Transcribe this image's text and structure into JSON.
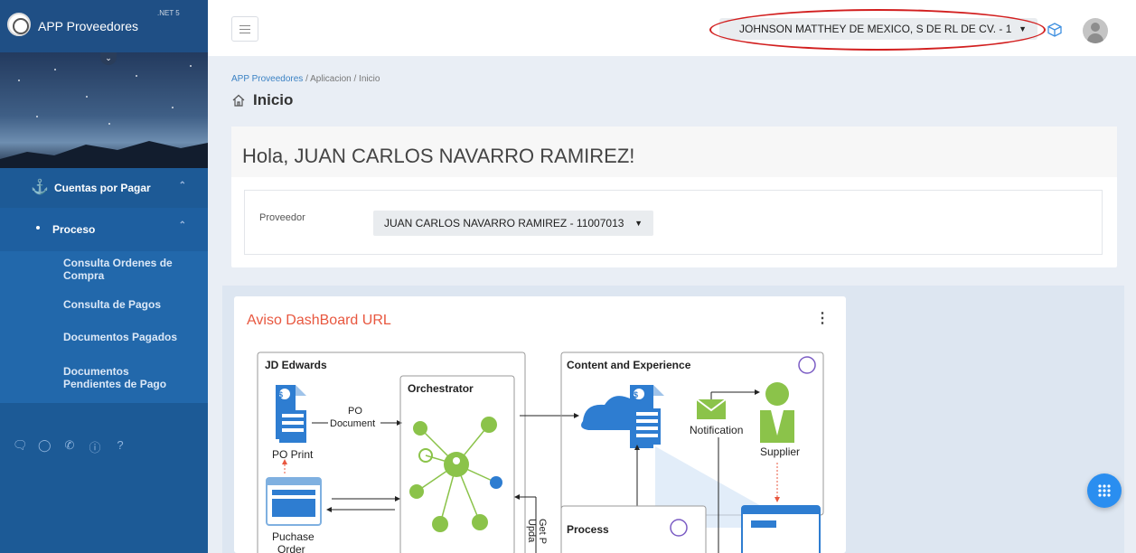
{
  "app": {
    "title": "APP Proveedores",
    "version": ".NET 5"
  },
  "sidebar": {
    "section": {
      "label": "Cuentas por Pagar"
    },
    "group": {
      "label": "Proceso"
    },
    "items": [
      {
        "label": "Consulta Ordenes de Compra"
      },
      {
        "label": "Consulta de Pagos"
      },
      {
        "label": "Documentos Pagados"
      },
      {
        "label": "Documentos Pendientes de Pago"
      }
    ],
    "footer_icons": [
      "chat-icon",
      "globe-icon",
      "phone-icon",
      "info-icon",
      "help-icon"
    ]
  },
  "header": {
    "company": "JOHNSON MATTHEY DE MEXICO, S DE RL DE CV. - 1"
  },
  "breadcrumb": {
    "root": "APP Proveedores",
    "section": "Aplicacion",
    "current": "Inicio"
  },
  "page": {
    "title": "Inicio",
    "greeting": "Hola, JUAN CARLOS NAVARRO RAMIREZ!",
    "provider_label": "Proveedor",
    "provider_value": "JUAN CARLOS NAVARRO RAMIREZ - 11007013"
  },
  "aviso": {
    "title": "Aviso DashBoard URL",
    "diagram": {
      "jde": "JD Edwards",
      "orchestrator": "Orchestrator",
      "content": "Content and Experience",
      "process": "Process",
      "po": "PO",
      "document": "Document",
      "po_print": "PO Print",
      "notification": "Notification",
      "supplier": "Supplier",
      "puchase": "Puchase",
      "order": "Order",
      "get": "Get P",
      "upd": "Upda"
    }
  },
  "colors": {
    "sidebar": "#1c5a96",
    "accent": "#2a8ef0",
    "title_orange": "#e8573f",
    "highlight_ellipse": "#d21f1f"
  }
}
